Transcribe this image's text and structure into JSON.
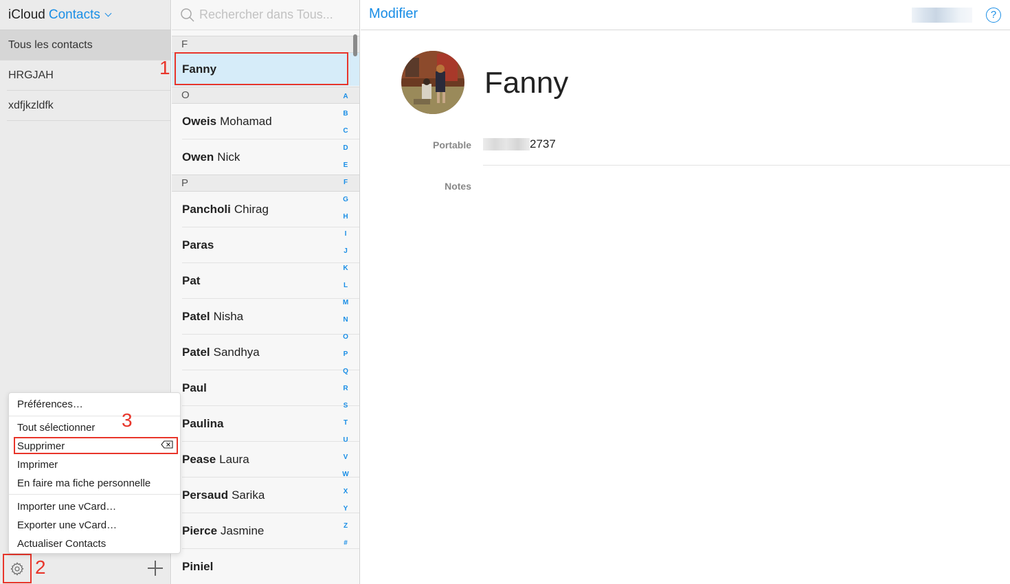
{
  "app": {
    "brand": "iCloud",
    "name": "Contacts"
  },
  "sidebar": {
    "groups": [
      {
        "label": "Tous les contacts"
      },
      {
        "label": "HRGJAH"
      },
      {
        "label": "xdfjkzldfk"
      }
    ]
  },
  "menu": {
    "items": [
      {
        "label": "Préférences…"
      },
      {
        "label": "Tout sélectionner"
      },
      {
        "label": "Supprimer"
      },
      {
        "label": "Imprimer"
      },
      {
        "label": "En faire ma fiche personnelle"
      },
      {
        "label": "Importer une vCard…"
      },
      {
        "label": "Exporter une vCard…"
      },
      {
        "label": "Actualiser Contacts"
      }
    ]
  },
  "annotations": {
    "step1": "1",
    "step2": "2",
    "step3": "3"
  },
  "search": {
    "placeholder": "Rechercher dans Tous..."
  },
  "contacts": {
    "sections": {
      "f": "F",
      "o": "O",
      "p": "P"
    },
    "selected": {
      "last": "Fanny"
    },
    "rows": [
      {
        "last": "Oweis",
        "first": "Mohamad"
      },
      {
        "last": "Owen",
        "first": "Nick"
      },
      {
        "last": "Pancholi",
        "first": "Chirag"
      },
      {
        "last": "Paras",
        "first": ""
      },
      {
        "last": "Pat",
        "first": ""
      },
      {
        "last": "Patel",
        "first": "Nisha"
      },
      {
        "last": "Patel",
        "first": "Sandhya"
      },
      {
        "last": "Paul",
        "first": ""
      },
      {
        "last": "Paulina",
        "first": ""
      },
      {
        "last": "Pease",
        "first": "Laura"
      },
      {
        "last": "Persaud",
        "first": "Sarika"
      },
      {
        "last": "Pierce",
        "first": "Jasmine"
      },
      {
        "last": "Piniel",
        "first": ""
      }
    ]
  },
  "alpha_index": [
    "A",
    "B",
    "C",
    "D",
    "E",
    "F",
    "G",
    "H",
    "I",
    "J",
    "K",
    "L",
    "M",
    "N",
    "O",
    "P",
    "Q",
    "R",
    "S",
    "T",
    "U",
    "V",
    "W",
    "X",
    "Y",
    "Z",
    "#"
  ],
  "detail": {
    "edit_label": "Modifier",
    "help_label": "?",
    "name": "Fanny",
    "fields": {
      "phone_label": "Portable",
      "phone_visible": "2737",
      "notes_label": "Notes"
    }
  },
  "colors": {
    "accent": "#1a8ee6",
    "annotation": "#e8352a",
    "selected_row": "#d6ecf9"
  }
}
